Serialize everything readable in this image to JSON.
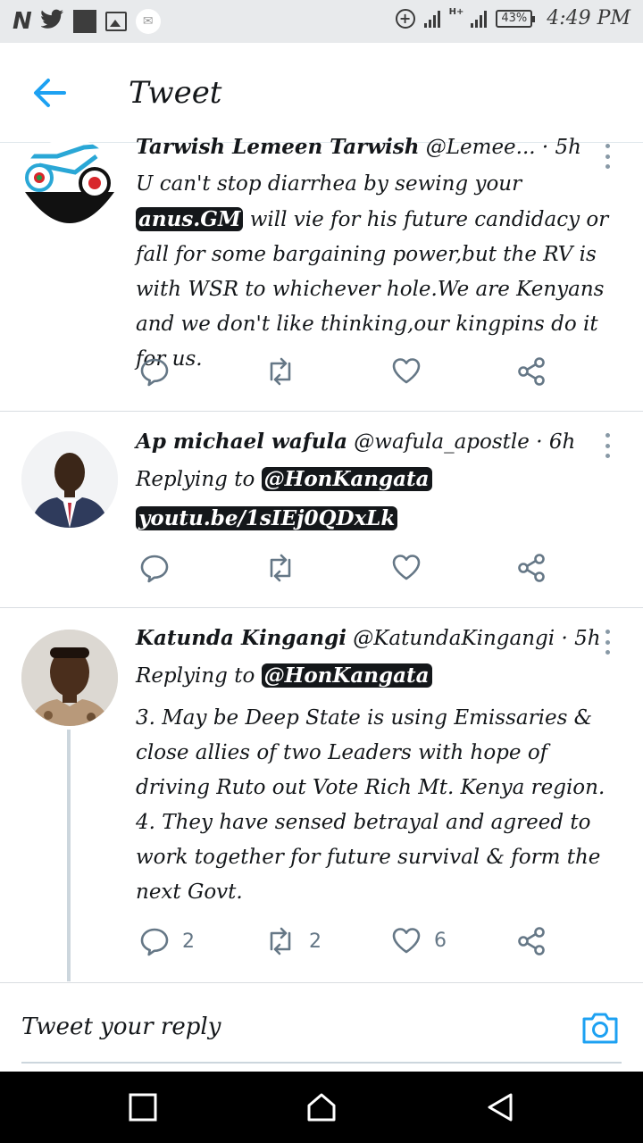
{
  "status_bar": {
    "left_icons": [
      "netflix-n-icon",
      "twitter-bird-icon",
      "black-square-icon",
      "gallery-icon",
      "mail-icon"
    ],
    "n_glyph": "N",
    "battery": "43%",
    "time": "4:49 PM"
  },
  "app_bar": {
    "title": "Tweet"
  },
  "tweets": [
    {
      "display_name": "Tarwish Lemeen Tarwish",
      "handle": "@Lemee...",
      "time": "· 5h",
      "text_parts": {
        "before": "U can't stop  diarrhea by sewing your ",
        "highlight": "anus.GM",
        "after": " will vie for his future candidacy or fall for some bargaining power,but the RV is with WSR to whichever hole.We are Kenyans and we don't like thinking,our kingpins do it for us."
      },
      "counts": {
        "reply": "",
        "retweet": "",
        "like": ""
      }
    },
    {
      "display_name": "Ap michael wafula",
      "handle": "@wafula_apostle",
      "time": "· 6h",
      "replying_label": "Replying to ",
      "replying_to": "@HonKangata",
      "link": "youtu.be/1sIEj0QDxLk",
      "counts": {
        "reply": "",
        "retweet": "",
        "like": ""
      }
    },
    {
      "display_name": "Katunda Kingangi",
      "handle": "@KatundaKingangi",
      "time": "· 5h",
      "replying_label": "Replying to ",
      "replying_to": "@HonKangata",
      "text": "3. May be Deep State is using Emissaries & close allies of two Leaders with hope of driving Ruto out Vote Rich Mt. Kenya region. 4. They have sensed betrayal and agreed to work together for future survival & form the next Govt.",
      "counts": {
        "reply": "2",
        "retweet": "2",
        "like": "6"
      }
    }
  ],
  "reply_bar": {
    "placeholder": "Tweet your reply"
  },
  "colors": {
    "accent": "#1da1f2",
    "icon_gray": "#657786",
    "divider": "#d9dde1"
  }
}
